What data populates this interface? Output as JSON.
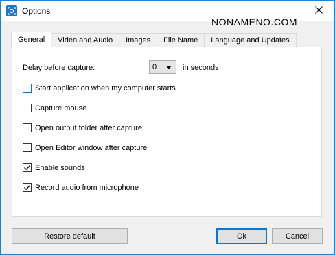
{
  "window": {
    "title": "Options",
    "watermark": "NONAMENO.COM"
  },
  "tabs": [
    {
      "label": "General",
      "active": true
    },
    {
      "label": "Video and Audio",
      "active": false
    },
    {
      "label": "Images",
      "active": false
    },
    {
      "label": "File Name",
      "active": false
    },
    {
      "label": "Language and Updates",
      "active": false
    }
  ],
  "general": {
    "delay_label": "Delay before capture:",
    "delay_value": "0",
    "delay_unit": "in seconds",
    "options": [
      {
        "label": "Start application when my computer starts",
        "checked": false
      },
      {
        "label": "Capture mouse",
        "checked": false
      },
      {
        "label": "Open output folder after capture",
        "checked": false
      },
      {
        "label": "Open Editor window after capture",
        "checked": false
      },
      {
        "label": "Enable sounds",
        "checked": true
      },
      {
        "label": "Record audio from microphone",
        "checked": true
      }
    ]
  },
  "buttons": {
    "restore": "Restore default",
    "ok": "Ok",
    "cancel": "Cancel"
  },
  "colors": {
    "accent": "#0078d7",
    "window_border": "#1883d7",
    "icon": "#1e74c7"
  }
}
